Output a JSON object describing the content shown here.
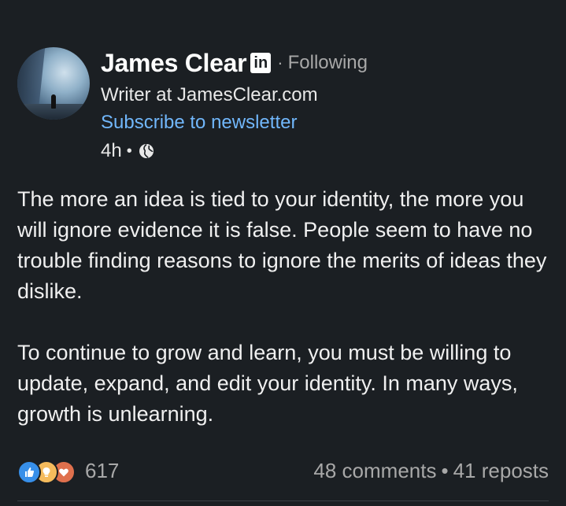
{
  "author": {
    "name": "James Clear",
    "badge": "in",
    "follow_status": "Following",
    "headline": "Writer at JamesClear.com",
    "subscribe_label": "Subscribe to newsletter"
  },
  "post": {
    "time_ago": "4h",
    "visibility_icon": "globe-icon",
    "paragraphs": [
      "The more an idea is tied to your identity, the more you will ignore evidence it is false. People seem to have no trouble finding reasons to ignore the merits of ideas they dislike.",
      "To continue to grow and learn, you must be willing to update, expand, and edit your identity. In many ways, growth is unlearning."
    ]
  },
  "social": {
    "reaction_icons": [
      "like-icon",
      "insightful-icon",
      "love-icon"
    ],
    "reaction_count": "617",
    "comments": "48 comments",
    "reposts": "41 reposts"
  },
  "colors": {
    "background": "#1b1f23",
    "link": "#71b7fb",
    "muted": "#a8a8a8",
    "like": "#378fe9",
    "insightful": "#f5bb5c",
    "love": "#df704d"
  }
}
